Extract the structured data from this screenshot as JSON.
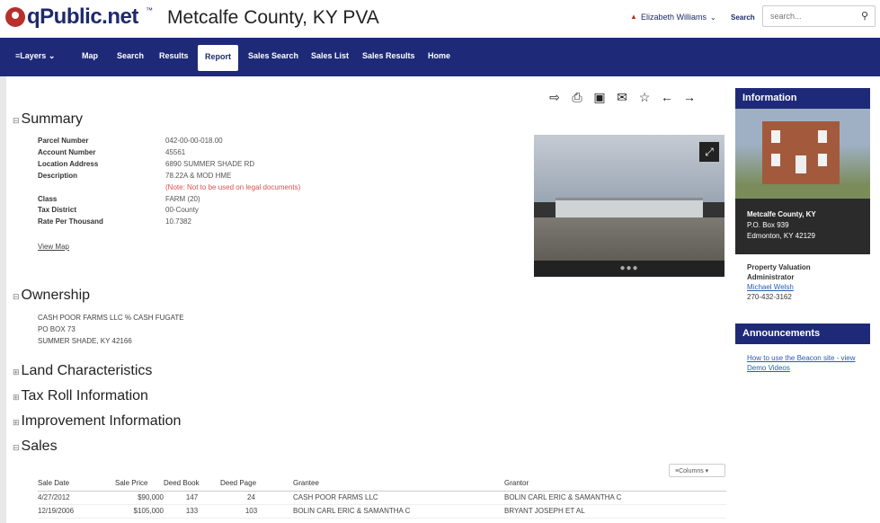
{
  "header": {
    "logo_text": "qPublic.net",
    "logo_tm": "™",
    "county_title": "Metcalfe County, KY PVA",
    "user_name": "Elizabeth Williams",
    "search_label": "Search",
    "search_placeholder": "search..."
  },
  "nav": {
    "items": [
      "Layers",
      "Map",
      "Search",
      "Results",
      "Report",
      "Sales Search",
      "Sales List",
      "Sales Results",
      "Home"
    ],
    "active": "Report"
  },
  "summary": {
    "title": "Summary",
    "fields": [
      {
        "label": "Parcel Number",
        "value": "042-00-00-018.00"
      },
      {
        "label": "Account Number",
        "value": "45561"
      },
      {
        "label": "Location Address",
        "value": "6890 SUMMER SHADE RD"
      },
      {
        "label": "Description",
        "value": "78.22A & MOD HME"
      },
      {
        "label": "Class",
        "value": "FARM (20)"
      },
      {
        "label": "Tax District",
        "value": "00-County"
      },
      {
        "label": "Rate Per Thousand",
        "value": "10.7382"
      }
    ],
    "description_note": "(Note: Not to be used on legal documents)",
    "view_map": "View Map"
  },
  "ownership": {
    "title": "Ownership",
    "lines": [
      "CASH POOR FARMS LLC % CASH FUGATE",
      "PO BOX 73",
      "SUMMER SHADE, KY 42166"
    ]
  },
  "collapsed_sections": [
    "Land Characteristics",
    "Tax Roll Information",
    "Improvement Information"
  ],
  "sales": {
    "title": "Sales",
    "columns_button": "Columns",
    "headers": [
      "Sale Date",
      "Sale Price",
      "Deed Book",
      "Deed Page",
      "Grantee",
      "Grantor"
    ],
    "rows": [
      [
        "4/27/2012",
        "$90,000",
        "147",
        "24",
        "CASH POOR FARMS LLC",
        "BOLIN CARL ERIC & SAMANTHA C"
      ],
      [
        "12/19/2006",
        "$105,000",
        "133",
        "103",
        "BOLIN CARL ERIC & SAMANTHA C",
        "BRYANT JOSEPH ET AL"
      ]
    ]
  },
  "info_panel": {
    "title": "Information",
    "address_name": "Metcalfe County, KY",
    "address_line1": "P.O. Box 939",
    "address_line2": "Edmonton, KY 42129",
    "pva_line1": "Property Valuation",
    "pva_line2": "Administrator",
    "pva_name": "Michael Welsh",
    "pva_phone": "270-432-3162"
  },
  "announcements": {
    "title": "Announcements",
    "link": "How to use the Beacon site - view Demo Videos"
  },
  "colors": {
    "nav_bg": "#1e2a78",
    "logo_red": "#b8302b",
    "link": "#2a5db0",
    "note_red": "#d9534f"
  }
}
